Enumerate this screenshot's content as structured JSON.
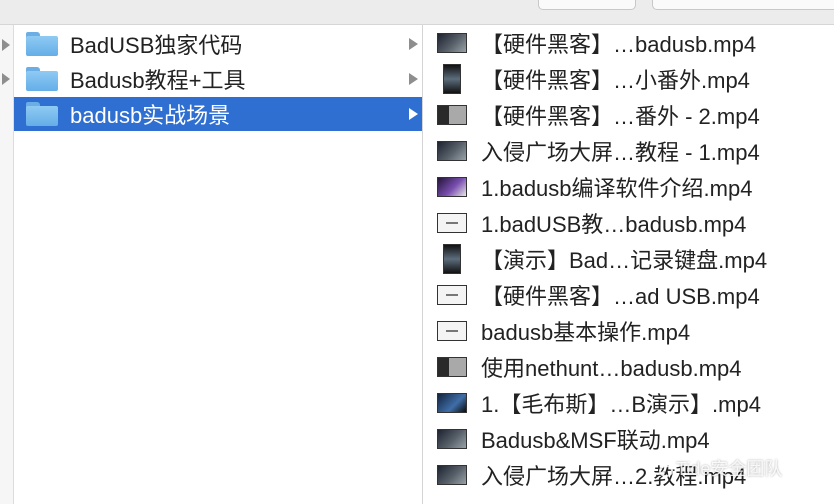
{
  "folders": [
    {
      "label": "BadUSB独家代码",
      "selected": false
    },
    {
      "label": "Badusb教程+工具",
      "selected": false
    },
    {
      "label": "badusb实战场景",
      "selected": true
    }
  ],
  "files": [
    {
      "label": "【硬件黑客】…badusb.mp4",
      "thumb": "dark"
    },
    {
      "label": "【硬件黑客】…小番外.mp4",
      "thumb": "tall"
    },
    {
      "label": "【硬件黑客】…番外 - 2.mp4",
      "thumb": "mixed"
    },
    {
      "label": "入侵广场大屏…教程 - 1.mp4",
      "thumb": "dark"
    },
    {
      "label": "1.badusb编译软件介绍.mp4",
      "thumb": "purple"
    },
    {
      "label": "1.badUSB教…badusb.mp4",
      "thumb": "light"
    },
    {
      "label": "【演示】Bad…记录键盘.mp4",
      "thumb": "tall"
    },
    {
      "label": "【硬件黑客】…ad USB.mp4",
      "thumb": "light"
    },
    {
      "label": "badusb基本操作.mp4",
      "thumb": "light"
    },
    {
      "label": "使用nethunt…badusb.mp4",
      "thumb": "mixed"
    },
    {
      "label": "1.【毛布斯】…B演示】.mp4",
      "thumb": "blue"
    },
    {
      "label": "Badusb&MSF联动.mp4",
      "thumb": "dark"
    },
    {
      "label": "入侵广场大屏…2.教程.mp4",
      "thumb": "dark"
    }
  ],
  "watermark": {
    "text": "Tide安全团队",
    "icon": "wechat-icon"
  },
  "colors": {
    "selection": "#2f6fd1",
    "folder": "#74b8ec"
  }
}
